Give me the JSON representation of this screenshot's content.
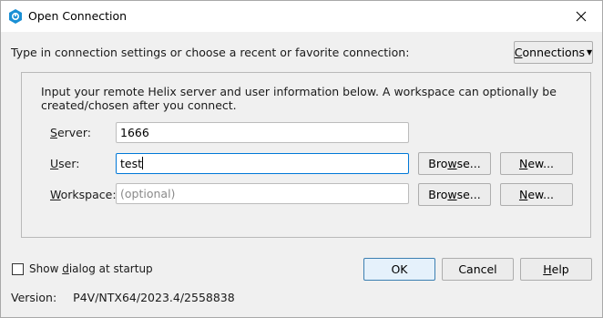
{
  "window": {
    "title": "Open Connection"
  },
  "intro_text": "Type in connection settings or choose a recent or favorite connection:",
  "connections_button": {
    "label": "Connections",
    "mnemonic_rest": "onnections"
  },
  "panel": {
    "description": "Input your remote Helix server and user information below. A workspace can optionally be created/chosen after you connect.",
    "server": {
      "label": "Server:",
      "value": "1666"
    },
    "user": {
      "label": "User:",
      "value": "test",
      "browse_label": "Browse...",
      "new_label": "New..."
    },
    "workspace": {
      "label": "Workspace:",
      "value": "",
      "placeholder": "(optional)",
      "browse_label": "Browse...",
      "new_label": "New..."
    }
  },
  "show_dialog": {
    "label": "Show dialog at startup",
    "checked": false
  },
  "buttons": {
    "ok": "OK",
    "cancel": "Cancel",
    "help": "Help"
  },
  "version": {
    "label": "Version:",
    "value": "P4V/NTX64/2023.4/2558838"
  },
  "colors": {
    "accent": "#0078d7",
    "icon": "#1a8fd4"
  }
}
